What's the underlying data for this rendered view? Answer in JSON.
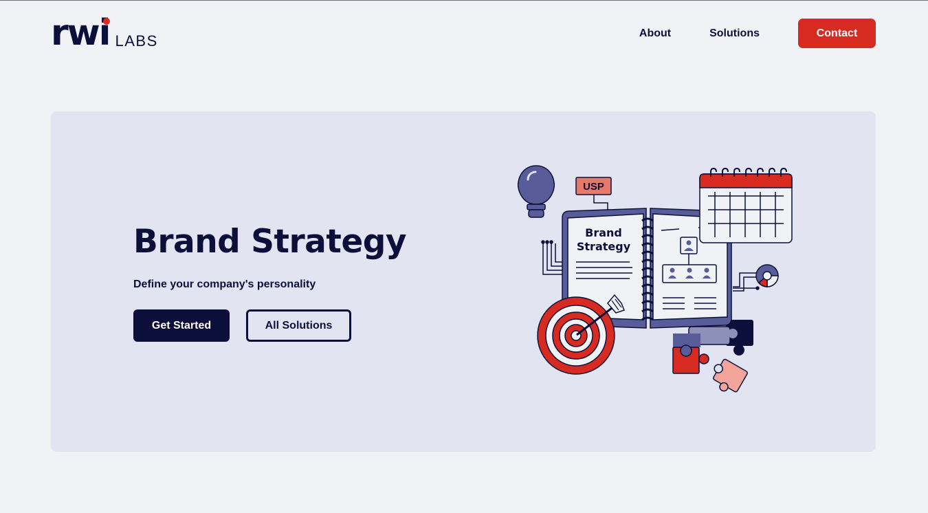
{
  "brand": {
    "logo_main": "rwi",
    "logo_sub": "LABS"
  },
  "nav": {
    "items": [
      "About",
      "Solutions"
    ],
    "contact_label": "Contact"
  },
  "hero": {
    "title": "Brand Strategy",
    "subtitle": "Define your company's personality",
    "primary_button": "Get Started",
    "secondary_button": "All Solutions"
  },
  "illustration": {
    "usp_label": "USP",
    "book_title_line1": "Brand",
    "book_title_line2": "Strategy",
    "icons": [
      "lightbulb-icon",
      "calendar-icon",
      "target-icon",
      "arrow-icon",
      "puzzle-icon",
      "pie-chart-icon",
      "org-chart-icon"
    ]
  },
  "colors": {
    "navy": "#0b0f3a",
    "red": "#d72a20",
    "purple": "#585d9a",
    "background": "#f1f2f6",
    "hero_bg": "#e2e5f1"
  }
}
